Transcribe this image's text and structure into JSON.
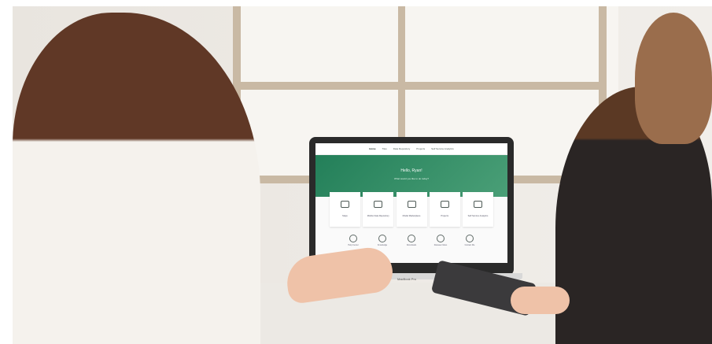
{
  "screen": {
    "nav": {
      "items": [
        "Home",
        "Tiles",
        "Data Repository",
        "Projects",
        "Self Service Analytics"
      ]
    },
    "hero": {
      "greeting": "Hello, Ryan!",
      "subtitle": "What would you like to do today?"
    },
    "cards": [
      {
        "label": "Maps",
        "icon": "globe-icon"
      },
      {
        "label": "Mobile Data Repository",
        "icon": "folder-icon"
      },
      {
        "label": "Model Marketplace",
        "icon": "grid-icon"
      },
      {
        "label": "Projects",
        "icon": "projects-icon"
      },
      {
        "label": "Self Service Analytics",
        "icon": "chart-icon"
      }
    ],
    "bottom_links": [
      {
        "label": "Help Center",
        "icon": "bulb-icon"
      },
      {
        "label": "Knowledge",
        "icon": "book-icon"
      },
      {
        "label": "Downloads",
        "icon": "download-icon"
      },
      {
        "label": "Release Notes",
        "icon": "calendar-icon"
      },
      {
        "label": "Contact Me",
        "icon": "chat-icon"
      }
    ]
  },
  "laptop": {
    "brand": "MacBook Pro"
  }
}
